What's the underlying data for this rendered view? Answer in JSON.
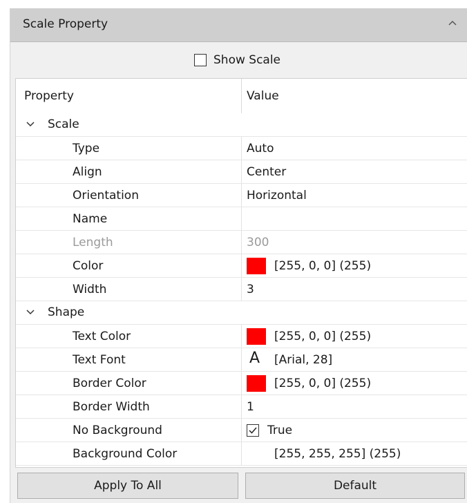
{
  "panel": {
    "title": "Scale Property",
    "show_scale": {
      "label": "Show Scale",
      "checked": false
    }
  },
  "grid": {
    "header": {
      "property": "Property",
      "value": "Value"
    },
    "groups": [
      {
        "name": "Scale",
        "rows": [
          {
            "name": "Type",
            "value": "Auto"
          },
          {
            "name": "Align",
            "value": "Center"
          },
          {
            "name": "Orientation",
            "value": "Horizontal"
          },
          {
            "name": "Name",
            "value": ""
          },
          {
            "name": "Length",
            "value": "300",
            "disabled": true
          },
          {
            "name": "Color",
            "value": "[255, 0, 0] (255)",
            "swatch": "#ff0000"
          },
          {
            "name": "Width",
            "value": "3"
          }
        ]
      },
      {
        "name": "Shape",
        "rows": [
          {
            "name": "Text Color",
            "value": "[255, 0, 0] (255)",
            "swatch": "#ff0000"
          },
          {
            "name": "Text Font",
            "value": "[Arial, 28]",
            "icon": "A"
          },
          {
            "name": "Border Color",
            "value": "[255, 0, 0] (255)",
            "swatch": "#ff0000"
          },
          {
            "name": "Border Width",
            "value": "1"
          },
          {
            "name": "No Background",
            "value": "True",
            "checked": true
          },
          {
            "name": "Background Color",
            "value": "[255, 255, 255] (255)",
            "swatch": "#ffffff"
          }
        ]
      }
    ]
  },
  "buttons": {
    "apply": "Apply To All",
    "default": "Default"
  }
}
